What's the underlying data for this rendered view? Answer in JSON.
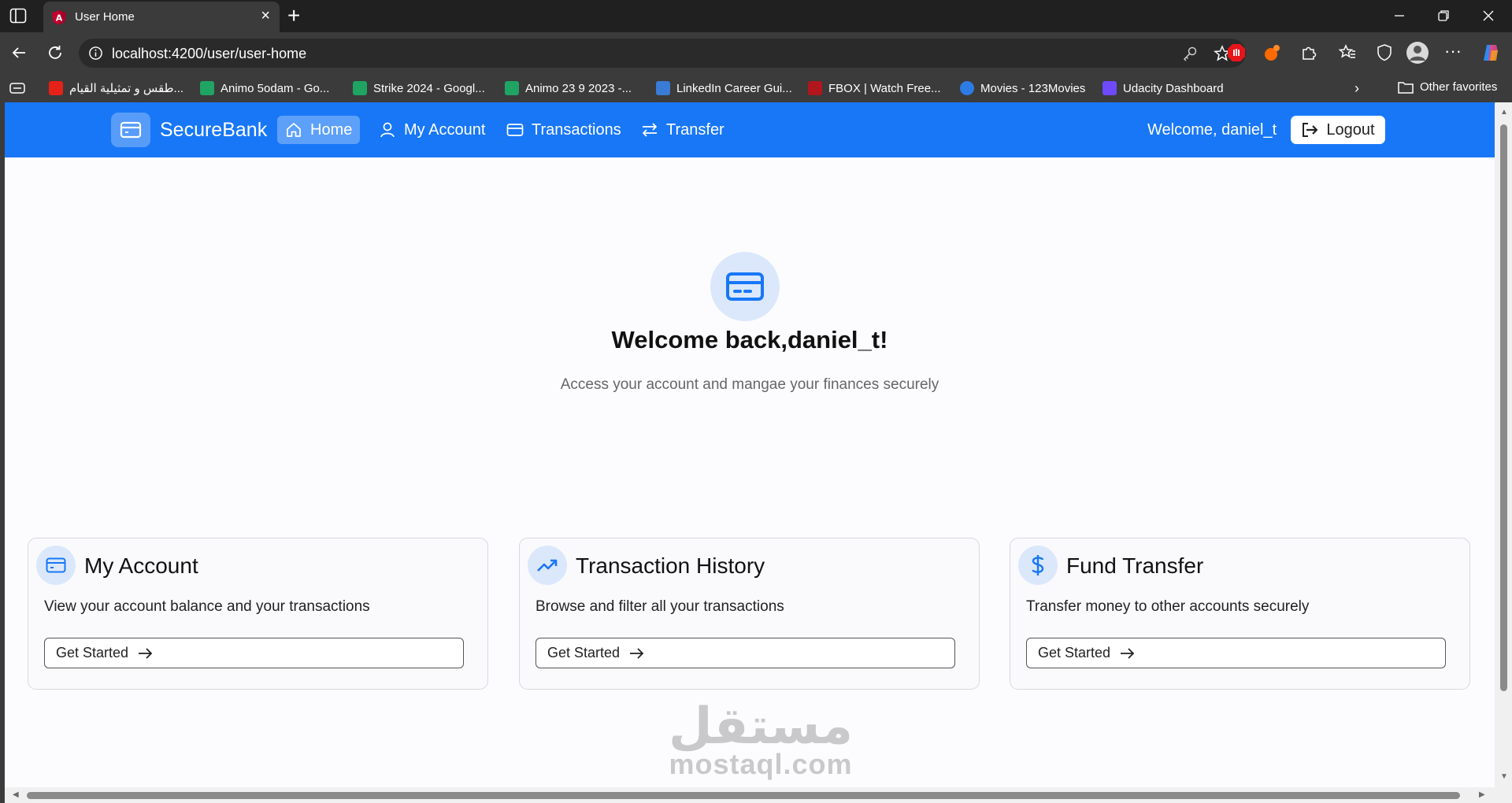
{
  "browser": {
    "tab_title": "User Home",
    "url": "localhost:4200/user/user-home",
    "bookmarks": [
      {
        "label": "طقس و تمثيلية القيام...",
        "icon": "youtube-icon",
        "color": "#e62117"
      },
      {
        "label": "Animo 5odam - Go...",
        "icon": "sheets-icon",
        "color": "#1fa463"
      },
      {
        "label": "Strike 2024 - Googl...",
        "icon": "sheets-icon",
        "color": "#1fa463"
      },
      {
        "label": "Animo 23 9 2023 -...",
        "icon": "sheets-icon",
        "color": "#1fa463"
      },
      {
        "label": "LinkedIn Career Gui...",
        "icon": "video-icon",
        "color": "#3a7bd5"
      },
      {
        "label": "FBOX | Watch Free...",
        "icon": "fbox-icon",
        "color": "#b0161b"
      },
      {
        "label": "Movies - 123Movies",
        "icon": "play-icon",
        "color": "#2d7be5"
      },
      {
        "label": "Udacity Dashboard",
        "icon": "udacity-icon",
        "color": "#6d4aff"
      }
    ],
    "other_favorites": "Other favorites"
  },
  "app": {
    "brand": "SecureBank",
    "nav": {
      "home": "Home",
      "account": "My Account",
      "transactions": "Transactions",
      "transfer": "Transfer"
    },
    "welcome_user": "Welcome, daniel_t",
    "logout": "Logout",
    "accent_color": "#1877f7"
  },
  "hero": {
    "title": "Welcome back,daniel_t!",
    "subtitle": "Access your account and mangae your finances securely"
  },
  "cards": [
    {
      "title": "My Account",
      "description": "View your account balance and your transactions",
      "button": "Get Started",
      "icon": "credit-card-icon"
    },
    {
      "title": "Transaction History",
      "description": "Browse and filter all your transactions",
      "button": "Get Started",
      "icon": "trending-up-icon"
    },
    {
      "title": "Fund Transfer",
      "description": "Transfer money to other accounts securely",
      "button": "Get Started",
      "icon": "dollar-icon"
    }
  ],
  "watermark": {
    "arabic": "مستقل",
    "latin": "mostaql.com"
  }
}
